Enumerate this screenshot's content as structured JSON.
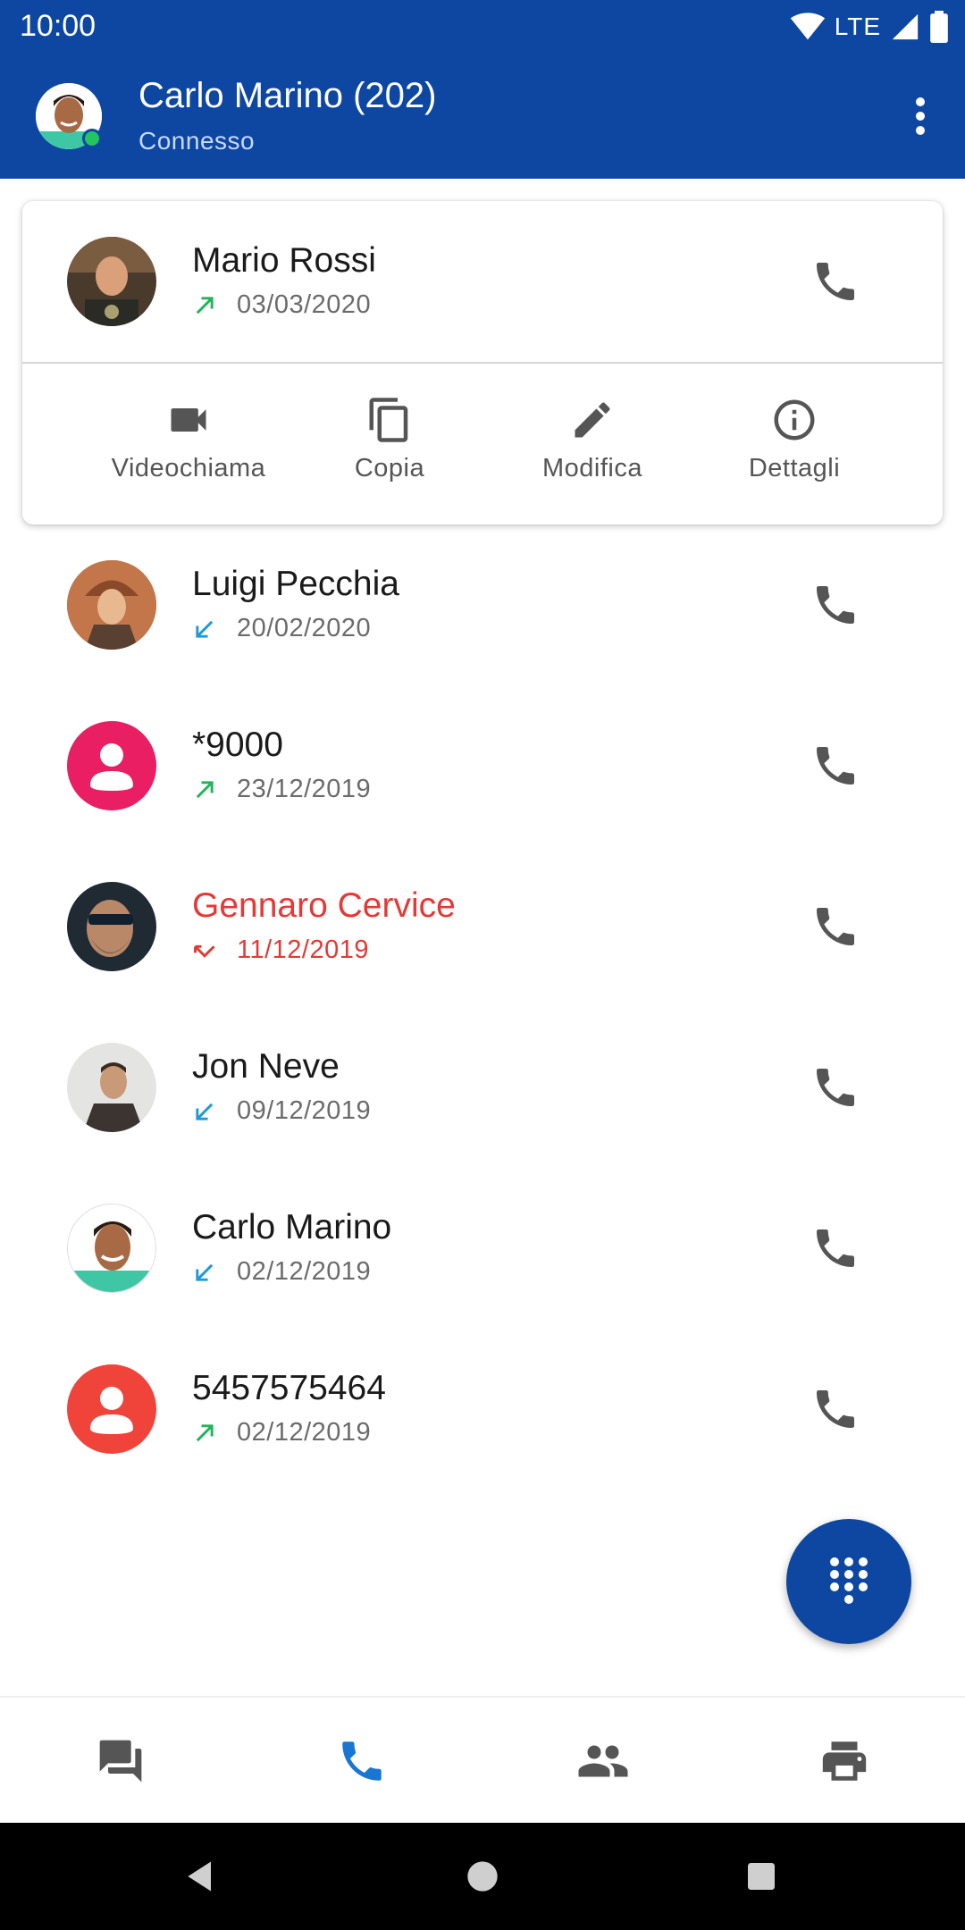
{
  "status_bar": {
    "time": "10:00",
    "network": "LTE"
  },
  "appbar": {
    "title": "Carlo Marino (202)",
    "subtitle": "Connesso",
    "presence_color": "#22c55e"
  },
  "colors": {
    "primary": "#0d47a1",
    "outgoing": "#22b35b",
    "incoming": "#1e9ad6",
    "missed": "#e53935",
    "nav_active": "#1976d2"
  },
  "expanded_call": {
    "name": "Mario Rossi",
    "direction": "outgoing",
    "date": "03/03/2020",
    "actions": [
      {
        "label": "Videochiama",
        "icon": "videocam-icon"
      },
      {
        "label": "Copia",
        "icon": "copy-icon"
      },
      {
        "label": "Modifica",
        "icon": "edit-icon"
      },
      {
        "label": "Dettagli",
        "icon": "info-icon"
      }
    ]
  },
  "calls": [
    {
      "name": "Luigi Pecchia",
      "direction": "incoming",
      "date": "20/02/2020",
      "avatar": "photo"
    },
    {
      "name": "*9000",
      "direction": "outgoing",
      "date": "23/12/2019",
      "avatar": "placeholder-pink"
    },
    {
      "name": "Gennaro Cervice",
      "direction": "missed",
      "date": "11/12/2019",
      "avatar": "photo"
    },
    {
      "name": "Jon Neve",
      "direction": "incoming",
      "date": "09/12/2019",
      "avatar": "photo"
    },
    {
      "name": "Carlo Marino",
      "direction": "incoming",
      "date": "02/12/2019",
      "avatar": "photo"
    },
    {
      "name": "5457575464",
      "direction": "outgoing",
      "date": "02/12/2019",
      "avatar": "placeholder-red"
    }
  ],
  "bottom_nav": [
    {
      "icon": "chat-icon",
      "active": false
    },
    {
      "icon": "phone-icon",
      "active": true
    },
    {
      "icon": "contacts-icon",
      "active": false
    },
    {
      "icon": "fax-icon",
      "active": false
    }
  ]
}
